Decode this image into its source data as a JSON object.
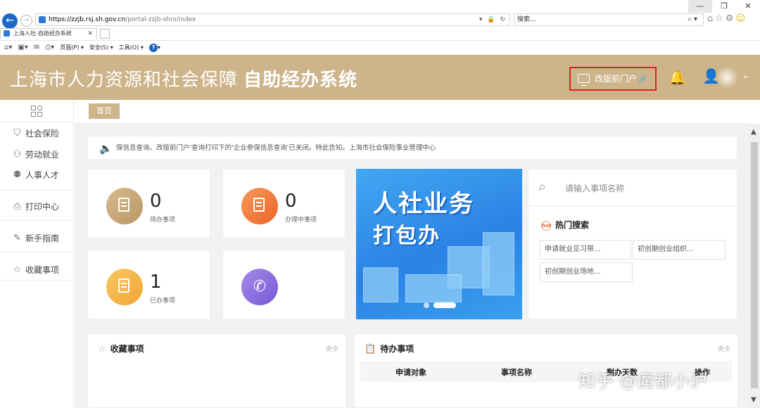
{
  "browser": {
    "url_host": "https://zzjb.rsj.sh.gov.cn",
    "url_path": "/portal-zzjb-shrs/index",
    "search_placeholder": "搜索...",
    "tab_title": "上海人社-自助经办系统",
    "menu": {
      "page": "页面(P) ▾",
      "safety": "安全(S) ▾",
      "tools": "工具(O) ▾"
    }
  },
  "header": {
    "title_main": "上海市人力资源和社会保障",
    "title_sub": "自助经办系统",
    "old_portal_label": "改版前门户"
  },
  "sidebar": {
    "items": [
      {
        "label": "社会保险",
        "icon": "shield-icon"
      },
      {
        "label": "劳动就业",
        "icon": "worker-icon"
      },
      {
        "label": "人事人才",
        "icon": "people-icon"
      },
      {
        "label": "打印中心",
        "icon": "printer-icon"
      },
      {
        "label": "新手指南",
        "icon": "guide-icon"
      },
      {
        "label": "收藏事项",
        "icon": "star-icon"
      }
    ]
  },
  "breadcrumb": {
    "home": "首页"
  },
  "notice": {
    "text": "保信息查询。改版前门户'查询打印下的'企业参保信息查询'已关闭。特此告知。上海市社会保险事业管理中心"
  },
  "stats": [
    {
      "count": "0",
      "label": "待办事项",
      "color": "#c8a877"
    },
    {
      "count": "0",
      "label": "办理中事项",
      "color": "#f07a3a"
    },
    {
      "count": "1",
      "label": "已办事项",
      "color": "#f5b84c"
    }
  ],
  "banner": {
    "line1": "人社业务",
    "line2": "打包办"
  },
  "search": {
    "placeholder": "请输入事项名称",
    "hot_title": "热门搜索",
    "hot_tags": [
      "申请就业见习带...",
      "初创期创业组织...",
      "初创期创业场地..."
    ]
  },
  "favorites": {
    "title": "收藏事项",
    "more": "更多"
  },
  "todo": {
    "title": "待办事项",
    "more": "更多",
    "columns": [
      "申请对象",
      "事项名称",
      "剩办天数",
      "操作"
    ]
  },
  "watermark": "知乎 @魔都小沪"
}
